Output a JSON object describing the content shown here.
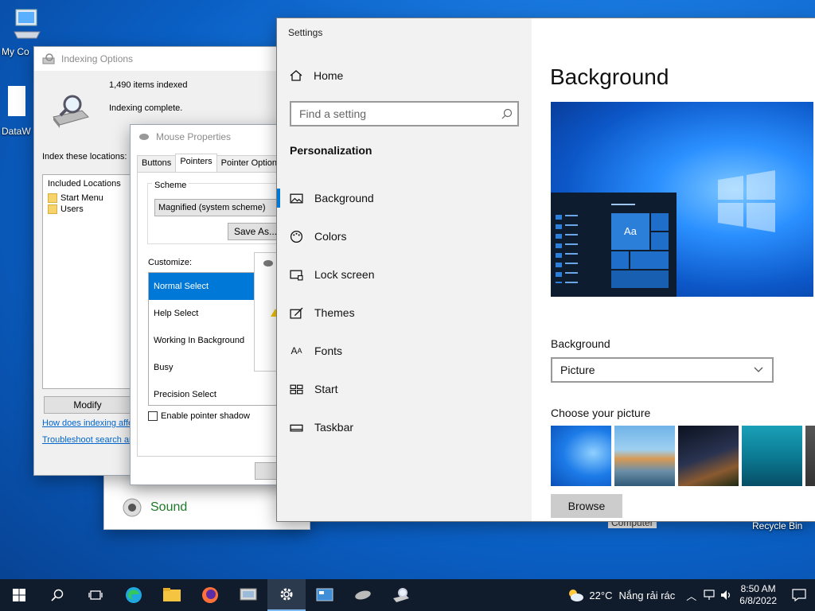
{
  "desktop": {
    "icons": [
      {
        "label": "My Co"
      },
      {
        "label": "DataW"
      }
    ],
    "recycle_bin": "Recycle Bin",
    "computer_label": "Computer"
  },
  "control_panel": {
    "sound": "Sound"
  },
  "indexing": {
    "title": "Indexing Options",
    "items_indexed": "1,490 items indexed",
    "status": "Indexing complete.",
    "index_label": "Index these locations:",
    "list_header": "Included Locations",
    "locations": [
      "Start Menu",
      "Users"
    ],
    "modify": "Modify",
    "link1": "How does indexing affe",
    "link2": "Troubleshoot search an"
  },
  "mouse": {
    "title": "Mouse Properties",
    "tabs": [
      "Buttons",
      "Pointers",
      "Pointer Options"
    ],
    "scheme_label": "Scheme",
    "scheme_value": "Magnified (system scheme)",
    "save_as": "Save As...",
    "customize": "Customize:",
    "cursors": [
      "Normal Select",
      "Help Select",
      "Working In Background",
      "Busy",
      "Precision Select"
    ],
    "shadow": "Enable pointer shadow"
  },
  "settings": {
    "title": "Settings",
    "home": "Home",
    "search_placeholder": "Find a setting",
    "section": "Personalization",
    "nav": [
      {
        "label": "Background",
        "icon": "image-icon"
      },
      {
        "label": "Colors",
        "icon": "palette-icon"
      },
      {
        "label": "Lock screen",
        "icon": "lock-screen-icon"
      },
      {
        "label": "Themes",
        "icon": "themes-icon"
      },
      {
        "label": "Fonts",
        "icon": "fonts-icon"
      },
      {
        "label": "Start",
        "icon": "start-icon"
      },
      {
        "label": "Taskbar",
        "icon": "taskbar-icon"
      }
    ],
    "heading": "Background",
    "preview_tile": "Aa",
    "bg_label": "Background",
    "bg_value": "Picture",
    "choose_label": "Choose your picture",
    "browse": "Browse"
  },
  "taskbar": {
    "weather_temp": "22°C",
    "weather_text": "Nắng rải rác",
    "time": "8:50 AM",
    "date": "6/8/2022"
  }
}
